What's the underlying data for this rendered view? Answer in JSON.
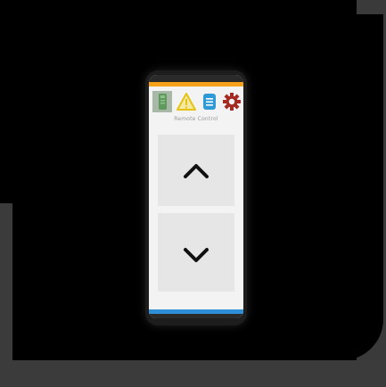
{
  "colors": {
    "top_accent": "#f5a21a",
    "bottom_accent": "#2e8fd6",
    "screen_bg": "#f3f3f3",
    "button_bg": "#e6e6e6",
    "chevron": "#111111",
    "remote_icon": "#6f9e6a",
    "warning_icon": "#e6c313",
    "document_icon": "#2f9ad8",
    "settings_icon": "#a42b24"
  },
  "toolbar": {
    "icons": [
      "remote-icon",
      "warning-icon",
      "document-icon",
      "gear-icon"
    ]
  },
  "screen": {
    "title": "Remote Control"
  },
  "controls": {
    "up_icon": "chevron-up-icon",
    "down_icon": "chevron-down-icon"
  }
}
